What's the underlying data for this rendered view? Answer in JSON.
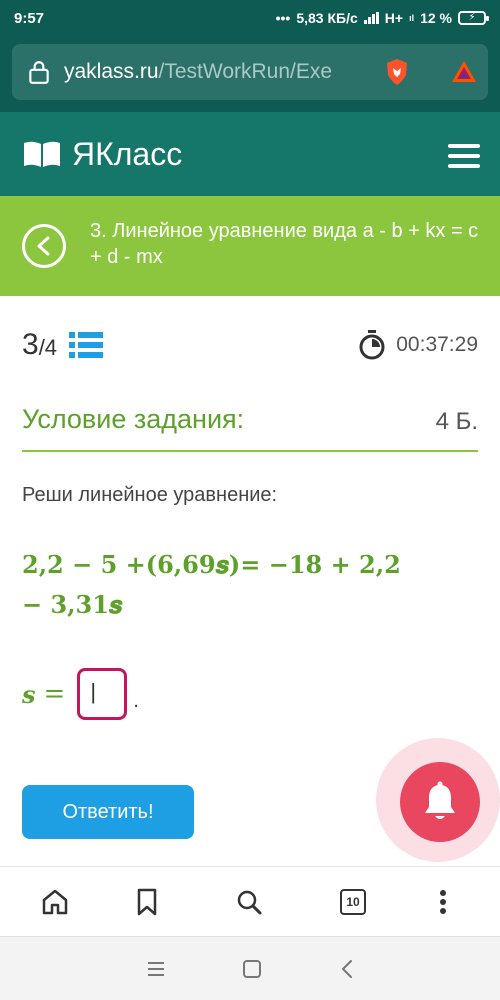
{
  "status": {
    "time": "9:57",
    "dots": "•••",
    "speed": "5,83 КБ/с",
    "network": "H+",
    "network_sub": "ıl",
    "battery": "12 %"
  },
  "browser": {
    "url_host": "yaklass.ru",
    "url_path": "/TestWorkRun/Exe"
  },
  "site": {
    "logo_text": "ЯКласс"
  },
  "topic": {
    "title": "3. Линейное уравнение вида a - b + kx = c + d - mx"
  },
  "task": {
    "current": "3",
    "total": "/4",
    "timer": "00:37:29",
    "condition_label": "Условие задания:",
    "points": "4 Б.",
    "instruction": "Реши линейное уравнение:",
    "equation_line1": "2,2 − 5 +(6,69𝒔)= −18 + 2,2",
    "equation_line2": "− 3,31𝒔",
    "answer_var": "s",
    "answer_eq": "=",
    "answer_value": "|",
    "answer_end": ".",
    "submit_label": "Ответить!"
  },
  "toolbar": {
    "tabs_count": "10"
  },
  "colors": {
    "status_bg": "#0e5b53",
    "header_bg": "#15776a",
    "topic_bg": "#8cc63e",
    "accent_green": "#5da02a",
    "submit_blue": "#1e9fe4",
    "bell_red": "#e8475f",
    "input_border": "#c2185b"
  }
}
